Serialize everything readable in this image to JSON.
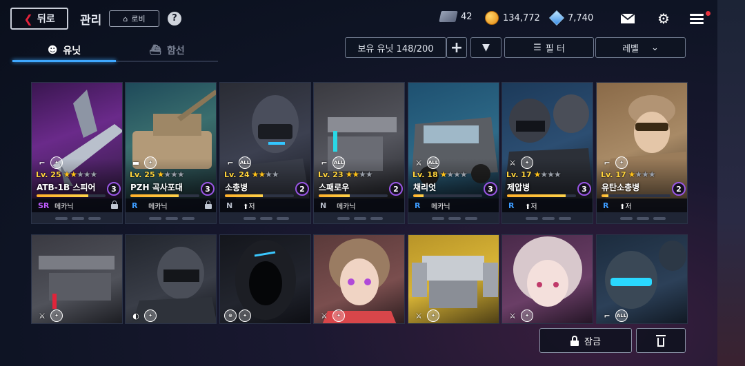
{
  "header": {
    "back_label": "뒤로",
    "title": "관리",
    "lobby_label": "로비",
    "help_label": "?",
    "resources": {
      "tickets": "42",
      "gold": "134,772",
      "gems": "7,740"
    }
  },
  "tabs": [
    {
      "label": "유닛",
      "active": true
    },
    {
      "label": "함선",
      "active": false
    }
  ],
  "toolbar": {
    "unit_count": "보유 유닛 148/200",
    "plus": "+",
    "sort_dir": "▼",
    "filter": "필 터",
    "sort": "레벨",
    "sort_caret": "⌄"
  },
  "units": [
    {
      "name": "ATB-1B 스피어",
      "level": "Lv. 25",
      "stars_on": "★★",
      "stars_off": "★★★",
      "cost": "3",
      "rarity": "SR",
      "type": "메카닉",
      "locked": true,
      "exp": 0.75
    },
    {
      "name": "PZH 곡사포대",
      "level": "Lv. 25",
      "stars_on": "★",
      "stars_off": "★★★",
      "cost": "3",
      "rarity": "R",
      "type": "메카닉",
      "locked": true,
      "exp": 0.7
    },
    {
      "name": "소총병",
      "level": "Lv. 24",
      "stars_on": "★★",
      "stars_off": "★★",
      "cost": "2",
      "rarity": "N",
      "type": "⬆저",
      "locked": false,
      "exp": 0.55
    },
    {
      "name": "스패로우",
      "level": "Lv. 23",
      "stars_on": "★★",
      "stars_off": "★★",
      "cost": "2",
      "rarity": "N",
      "type": "메카닉",
      "locked": false,
      "exp": 0.45
    },
    {
      "name": "채리엇",
      "level": "Lv. 18",
      "stars_on": "★",
      "stars_off": "★★★",
      "cost": "3",
      "rarity": "R",
      "type": "메카닉",
      "locked": false,
      "exp": 0.15
    },
    {
      "name": "제압병",
      "level": "Lv. 17",
      "stars_on": "★",
      "stars_off": "★★★",
      "cost": "3",
      "rarity": "R",
      "type": "⬆저",
      "locked": false,
      "exp": 0.85
    },
    {
      "name": "유탄소총병",
      "level": "Lv. 17",
      "stars_on": "★",
      "stars_off": "★★★",
      "cost": "2",
      "rarity": "R",
      "type": "⬆저",
      "locked": false,
      "exp": 0.1
    }
  ],
  "actions": {
    "lock_label": "잠금"
  },
  "icons": {
    "back": "chevron-left-icon",
    "lobby": "home-icon",
    "ticket": "ticket-icon",
    "gold": "gold-coin-icon",
    "gem": "diamond-icon",
    "mail": "mail-icon",
    "settings": "gear-icon",
    "menu": "hamburger-menu-icon",
    "unit_tab": "soldier-icon",
    "ship_tab": "ship-icon",
    "filter": "filter-icon",
    "lock": "lock-icon",
    "trash": "trash-icon"
  },
  "colors": {
    "accent_blue": "#3fa8ff",
    "level_yellow": "#ffd43b",
    "star_gold": "#ffc21a",
    "rarity_SR": "#c05cff",
    "rarity_R": "#3d9cff",
    "cost_ring": "#9a56e6",
    "notif_red": "#e8323d"
  }
}
